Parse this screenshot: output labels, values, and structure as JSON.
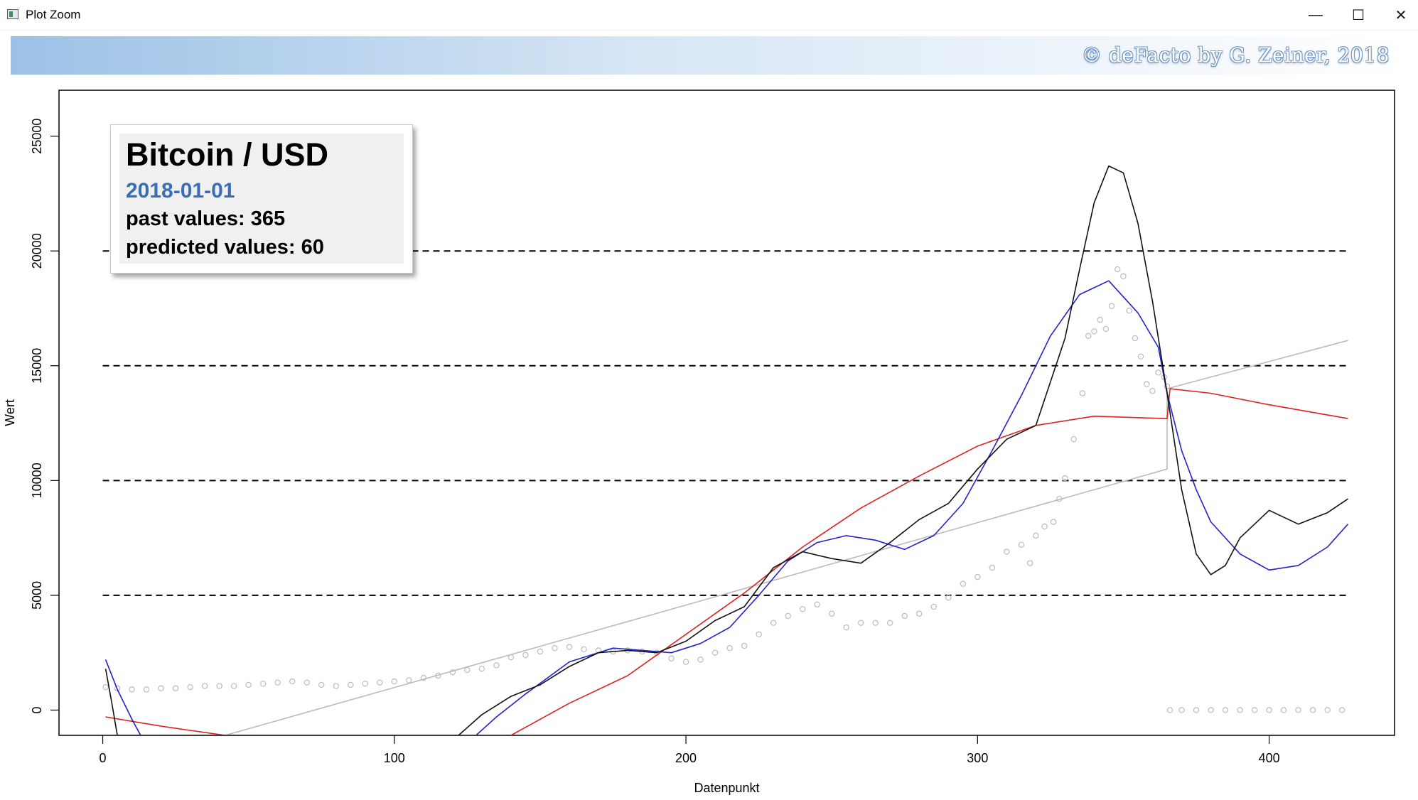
{
  "window": {
    "title": "Plot Zoom",
    "minimize_glyph": "—",
    "maximize_glyph": "☐",
    "close_glyph": "✕"
  },
  "banner": {
    "text": "© deFacto by G. Zeiner, 2018"
  },
  "legend": {
    "title": "Bitcoin / USD",
    "date": "2018-01-01",
    "past": "past values: 365",
    "predicted": "predicted values: 60",
    "date_color": "#3a6fb5"
  },
  "chart_data": {
    "type": "line",
    "xlabel": "Datenpunkt",
    "ylabel": "Wert",
    "xlim": [
      -15,
      443
    ],
    "ylim": [
      -1100,
      27000
    ],
    "x_ticks": [
      0,
      100,
      200,
      300,
      400
    ],
    "y_ticks": [
      0,
      5000,
      10000,
      15000,
      20000,
      25000
    ],
    "hlines": {
      "values": [
        5000,
        10000,
        15000,
        20000
      ],
      "x_range": [
        0,
        427
      ],
      "style": "dashed",
      "color": "#000000"
    },
    "series": [
      {
        "color": "#bbbbbb",
        "style": "points",
        "x": [
          1,
          5,
          10,
          15,
          20,
          25,
          30,
          35,
          40,
          45,
          50,
          55,
          60,
          65,
          70,
          75,
          80,
          85,
          90,
          95,
          100,
          105,
          110,
          115,
          120,
          125,
          130,
          135,
          140,
          145,
          150,
          155,
          160,
          165,
          170,
          175,
          180,
          185,
          190,
          195,
          200,
          205,
          210,
          215,
          220,
          225,
          230,
          235,
          240,
          245,
          250,
          255,
          260,
          265,
          270,
          275,
          280,
          285,
          290,
          295,
          300,
          305,
          310,
          315,
          318,
          320,
          323,
          326,
          328,
          330,
          333,
          336,
          338,
          340,
          342,
          344,
          346,
          348,
          350,
          352,
          354,
          356,
          358,
          360,
          362,
          364,
          365
        ],
        "y": [
          1000,
          950,
          900,
          900,
          950,
          950,
          1000,
          1050,
          1050,
          1050,
          1100,
          1150,
          1200,
          1250,
          1200,
          1100,
          1050,
          1100,
          1150,
          1200,
          1250,
          1300,
          1400,
          1500,
          1650,
          1750,
          1800,
          1950,
          2300,
          2400,
          2550,
          2700,
          2750,
          2650,
          2600,
          2550,
          2600,
          2550,
          2500,
          2250,
          2100,
          2200,
          2500,
          2700,
          2800,
          3300,
          3800,
          4100,
          4400,
          4600,
          4200,
          3600,
          3800,
          3800,
          3800,
          4100,
          4200,
          4500,
          4900,
          5500,
          5800,
          6200,
          6900,
          7200,
          6400,
          7600,
          8000,
          8200,
          9200,
          10100,
          11800,
          13800,
          16300,
          16500,
          17000,
          16600,
          17600,
          19200,
          18900,
          17400,
          16200,
          15400,
          14200,
          13900,
          14700,
          14500,
          14100
        ]
      },
      {
        "color": "#bbbbbb",
        "style": "points",
        "x": [
          366,
          370,
          375,
          380,
          385,
          390,
          395,
          400,
          405,
          410,
          415,
          420,
          425
        ],
        "y": [
          0,
          0,
          0,
          0,
          0,
          0,
          0,
          0,
          0,
          0,
          0,
          0,
          0
        ]
      },
      {
        "color": "#bbbbbb",
        "style": "line",
        "x": [
          42,
          365,
          365,
          427
        ],
        "y": [
          -1100,
          10500,
          14000,
          16100
        ]
      },
      {
        "color": "#dd2222",
        "style": "line",
        "x": [
          1,
          20,
          42,
          60,
          80,
          100,
          120,
          140,
          160,
          180,
          200,
          220,
          240,
          260,
          280,
          300,
          320,
          340,
          364,
          365,
          366,
          380,
          400,
          427
        ],
        "y": [
          -300,
          -700,
          -1100,
          -2200,
          -3400,
          -4100,
          -3500,
          -1100,
          300,
          1500,
          3300,
          5100,
          7100,
          8800,
          10200,
          11500,
          12400,
          12800,
          12700,
          12700,
          14000,
          13800,
          13300,
          12700
        ]
      },
      {
        "color": "#2222cc",
        "style": "line",
        "x": [
          1,
          5,
          10,
          13,
          120,
          128,
          135,
          145,
          160,
          175,
          185,
          195,
          205,
          215,
          225,
          235,
          245,
          255,
          265,
          275,
          285,
          295,
          305,
          315,
          325,
          335,
          345,
          355,
          362,
          365,
          370,
          375,
          380,
          390,
          400,
          410,
          420,
          427
        ],
        "y": [
          2200,
          900,
          -400,
          -1100,
          -4000,
          -1100,
          -300,
          700,
          2100,
          2700,
          2600,
          2500,
          2900,
          3600,
          5000,
          6500,
          7300,
          7600,
          7400,
          7000,
          7600,
          9000,
          11300,
          13700,
          16300,
          18100,
          18700,
          17300,
          15800,
          13800,
          11300,
          9600,
          8200,
          6800,
          6100,
          6300,
          7100,
          8100
        ]
      },
      {
        "color": "#111111",
        "style": "line",
        "x": [
          1,
          3,
          5,
          122,
          130,
          140,
          150,
          160,
          170,
          180,
          190,
          200,
          210,
          220,
          230,
          240,
          250,
          260,
          270,
          280,
          290,
          300,
          310,
          320,
          330,
          335,
          340,
          345,
          350,
          355,
          360,
          365,
          370,
          375,
          380,
          385,
          390,
          400,
          410,
          420,
          427
        ],
        "y": [
          1800,
          400,
          -1100,
          -1100,
          -200,
          600,
          1100,
          1900,
          2500,
          2600,
          2500,
          3000,
          3900,
          4500,
          6200,
          6900,
          6600,
          6400,
          7300,
          8300,
          9000,
          10500,
          11800,
          12400,
          16200,
          19200,
          22100,
          23700,
          23400,
          21200,
          17800,
          13800,
          9600,
          6800,
          5900,
          6300,
          7500,
          8700,
          8100,
          8600,
          9200
        ]
      }
    ]
  }
}
